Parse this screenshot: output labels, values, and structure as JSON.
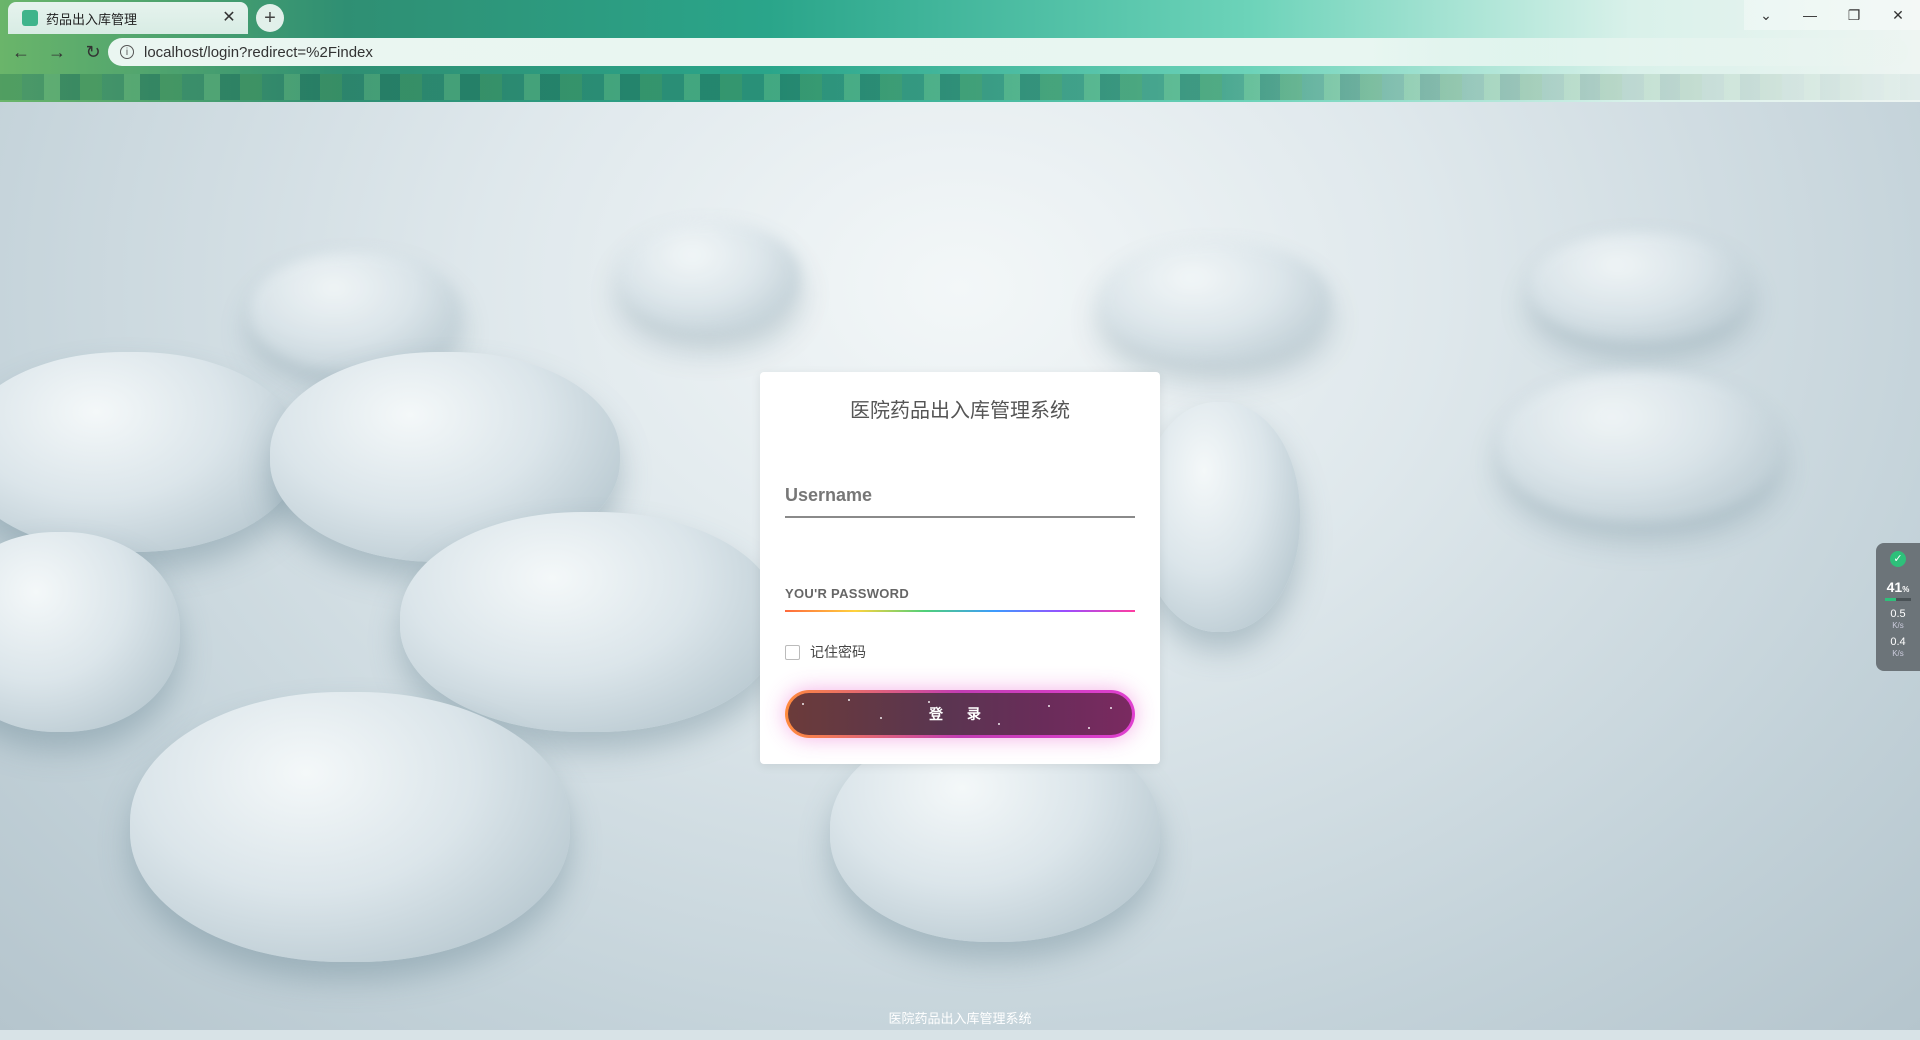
{
  "browser": {
    "tab": {
      "title": "药品出入库管理",
      "close_glyph": "✕"
    },
    "new_tab_glyph": "+",
    "window_controls": {
      "tabs_menu": "⌄",
      "minimize": "—",
      "restore": "❐",
      "close": "✕"
    },
    "nav": {
      "back": "←",
      "forward": "→",
      "reload": "↻"
    },
    "address": {
      "info_glyph": "i",
      "url": "localhost/login?redirect=%2Findex"
    }
  },
  "login": {
    "title": "医院药品出入库管理系统",
    "username_placeholder": "Username",
    "password_placeholder": "YOU'R PASSWORD",
    "remember_label": "记住密码",
    "remember_checked": false,
    "submit_label": "登 录"
  },
  "footer": {
    "text": "医院药品出入库管理系统"
  },
  "system_widget": {
    "memory_percent": "41",
    "memory_unit": "%",
    "memory_fraction": 0.41,
    "upload_speed": "0.5",
    "upload_unit": "K/s",
    "download_speed": "0.4",
    "download_unit": "K/s"
  },
  "colors": {
    "chrome_green": "#2aa58a",
    "button_border_start": "#ff8a3d",
    "button_border_end": "#e040d0",
    "button_fill": "#5a3550"
  }
}
